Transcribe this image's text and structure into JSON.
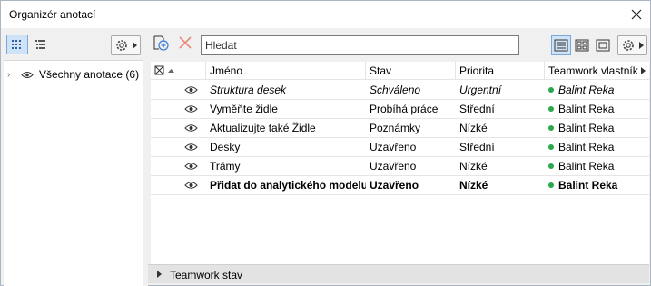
{
  "window": {
    "title": "Organizér anotací"
  },
  "left": {
    "tree": [
      {
        "label": "Všechny anotace (6)"
      }
    ]
  },
  "right": {
    "search": {
      "value": "Hledat"
    },
    "columns": [
      "Jméno",
      "Stav",
      "Priorita",
      "Teamwork vlastník"
    ],
    "rows": [
      {
        "name": "Struktura desek",
        "status": "Schváleno",
        "priority": "Urgentní",
        "owner": "Balint Reka",
        "style": "italic"
      },
      {
        "name": "Vyměňte židle",
        "status": "Probíhá práce",
        "priority": "Střední",
        "owner": "Balint Reka",
        "style": "normal"
      },
      {
        "name": "Aktualizujte také Židle",
        "status": "Poznámky",
        "priority": "Nízké",
        "owner": "Balint Reka",
        "style": "normal"
      },
      {
        "name": "Desky",
        "status": "Uzavřeno",
        "priority": "Střední",
        "owner": "Balint Reka",
        "style": "normal"
      },
      {
        "name": "Trámy",
        "status": "Uzavřeno",
        "priority": "Nízké",
        "owner": "Balint Reka",
        "style": "normal"
      },
      {
        "name": "Přidat do analytického modelu",
        "status": "Uzavřeno",
        "priority": "Nízké",
        "owner": "Balint Reka",
        "style": "bold"
      }
    ],
    "teamwork_section": {
      "label": "Teamwork stav"
    }
  },
  "colors": {
    "owner_dot": "#2aa84a",
    "selection": "#cfe3f6",
    "delete_x": "#e8877a",
    "add_icon": "#3a7bd5"
  }
}
